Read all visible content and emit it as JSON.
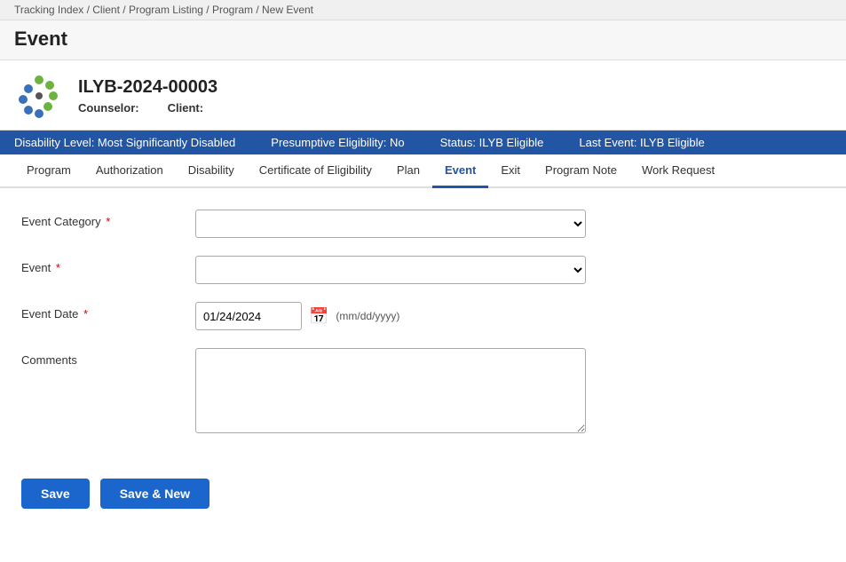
{
  "breadcrumb": {
    "text": "Tracking Index / Client / Program Listing / Program / New Event"
  },
  "page_title": "Event",
  "header": {
    "record_id": "ILYB-2024-00003",
    "counselor_label": "Counselor:",
    "counselor_value": "",
    "client_label": "Client:",
    "client_value": ""
  },
  "status_bar": {
    "disability_level": "Disability Level: Most Significantly Disabled",
    "presumptive_eligibility": "Presumptive Eligibility: No",
    "status": "Status: ILYB Eligible",
    "last_event": "Last Event: ILYB Eligible"
  },
  "tabs": [
    {
      "id": "program",
      "label": "Program",
      "active": false
    },
    {
      "id": "authorization",
      "label": "Authorization",
      "active": false
    },
    {
      "id": "disability",
      "label": "Disability",
      "active": false
    },
    {
      "id": "certificate-of-eligibility",
      "label": "Certificate of Eligibility",
      "active": false
    },
    {
      "id": "plan",
      "label": "Plan",
      "active": false
    },
    {
      "id": "event",
      "label": "Event",
      "active": true
    },
    {
      "id": "exit",
      "label": "Exit",
      "active": false
    },
    {
      "id": "program-note",
      "label": "Program Note",
      "active": false
    },
    {
      "id": "work-request",
      "label": "Work Request",
      "active": false
    }
  ],
  "form": {
    "event_category_label": "Event Category",
    "event_category_placeholder": "",
    "event_label": "Event",
    "event_placeholder": "",
    "event_date_label": "Event Date",
    "event_date_value": "01/24/2024",
    "event_date_format": "(mm/dd/yyyy)",
    "comments_label": "Comments",
    "comments_value": ""
  },
  "buttons": {
    "save_label": "Save",
    "save_new_label": "Save & New"
  }
}
